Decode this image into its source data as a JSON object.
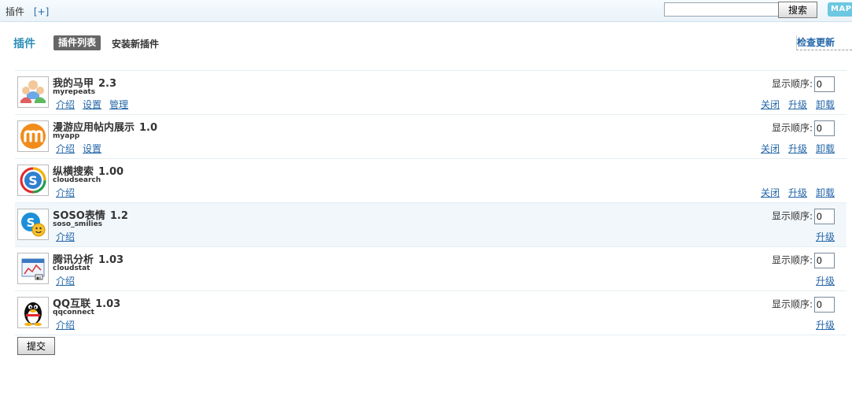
{
  "topbar": {
    "breadcrumb": "插件",
    "add_link": "[+]",
    "search_value": "",
    "search_button": "搜索",
    "map_button": "MAP"
  },
  "header": {
    "title": "插件",
    "tab_active": "插件列表",
    "tab_install": "安装新插件",
    "check_update": "检查更新"
  },
  "order_label": "显示顺序:",
  "plugins": [
    {
      "name": "我的马甲",
      "version": "2.3",
      "id": "myrepeats",
      "links": [
        "介绍",
        "设置",
        "管理"
      ],
      "order": "0",
      "actions": [
        "关闭",
        "升级",
        "卸载"
      ],
      "icon": "users-icon"
    },
    {
      "name": "漫游应用帖内展示",
      "version": "1.0",
      "id": "myapp",
      "links": [
        "介绍",
        "设置"
      ],
      "order": "0",
      "actions": [
        "关闭",
        "升级",
        "卸载"
      ],
      "icon": "myapp-logo-icon"
    },
    {
      "name": "纵横搜索",
      "version": "1.00",
      "id": "cloudsearch",
      "links": [
        "介绍"
      ],
      "order": null,
      "actions": [
        "关闭",
        "升级",
        "卸载"
      ],
      "icon": "cloudsearch-logo-icon"
    },
    {
      "name": "SOSO表情",
      "version": "1.2",
      "id": "soso_smilies",
      "links": [
        "介绍"
      ],
      "order": "0",
      "actions": [
        "升级"
      ],
      "icon": "soso-smiley-icon"
    },
    {
      "name": "腾讯分析",
      "version": "1.03",
      "id": "cloudstat",
      "links": [
        "介绍"
      ],
      "order": "0",
      "actions": [
        "升级"
      ],
      "icon": "stats-chart-icon"
    },
    {
      "name": "QQ互联",
      "version": "1.03",
      "id": "qqconnect",
      "links": [
        "介绍"
      ],
      "order": "0",
      "actions": [
        "升级"
      ],
      "icon": "qq-penguin-icon"
    }
  ],
  "submit_button": "提交"
}
